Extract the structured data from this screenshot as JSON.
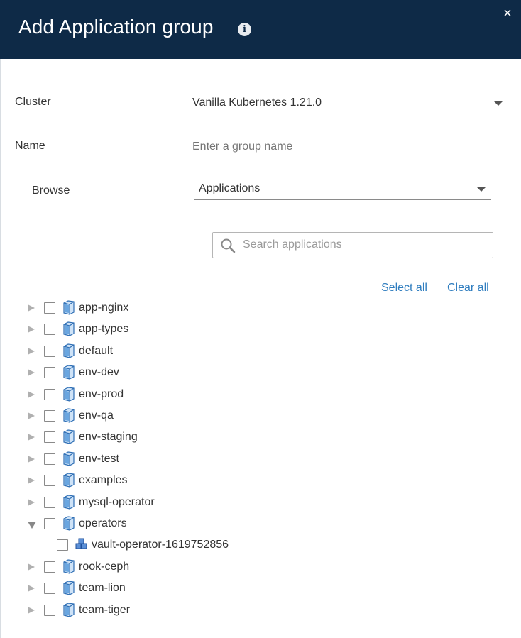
{
  "header": {
    "title": "Add Application group",
    "info_icon": "info-icon",
    "close_icon": "close-icon",
    "close_symbol": "×"
  },
  "form": {
    "cluster_label": "Cluster",
    "cluster_value": "Vanilla Kubernetes 1.21.0",
    "name_label": "Name",
    "name_placeholder": "Enter a group name",
    "browse_label": "Browse",
    "browse_value": "Applications"
  },
  "search": {
    "placeholder": "Search applications",
    "icon": "search-icon"
  },
  "actions": {
    "select_all": "Select all",
    "clear_all": "Clear all"
  },
  "tree": [
    {
      "label": "app-nginx",
      "level": 0,
      "expanded": false,
      "type": "namespace"
    },
    {
      "label": "app-types",
      "level": 0,
      "expanded": false,
      "type": "namespace"
    },
    {
      "label": "default",
      "level": 0,
      "expanded": false,
      "type": "namespace"
    },
    {
      "label": "env-dev",
      "level": 0,
      "expanded": false,
      "type": "namespace"
    },
    {
      "label": "env-prod",
      "level": 0,
      "expanded": false,
      "type": "namespace"
    },
    {
      "label": "env-qa",
      "level": 0,
      "expanded": false,
      "type": "namespace"
    },
    {
      "label": "env-staging",
      "level": 0,
      "expanded": false,
      "type": "namespace"
    },
    {
      "label": "env-test",
      "level": 0,
      "expanded": false,
      "type": "namespace"
    },
    {
      "label": "examples",
      "level": 0,
      "expanded": false,
      "type": "namespace"
    },
    {
      "label": "mysql-operator",
      "level": 0,
      "expanded": false,
      "type": "namespace"
    },
    {
      "label": "operators",
      "level": 0,
      "expanded": true,
      "type": "namespace"
    },
    {
      "label": "vault-operator-1619752856",
      "level": 1,
      "expanded": false,
      "type": "application"
    },
    {
      "label": "rook-ceph",
      "level": 0,
      "expanded": false,
      "type": "namespace"
    },
    {
      "label": "team-lion",
      "level": 0,
      "expanded": false,
      "type": "namespace"
    },
    {
      "label": "team-tiger",
      "level": 0,
      "expanded": false,
      "type": "namespace"
    }
  ],
  "colors": {
    "header_bg": "#0e2a47",
    "link": "#2f7dbf",
    "folder": "#4a90d9"
  }
}
